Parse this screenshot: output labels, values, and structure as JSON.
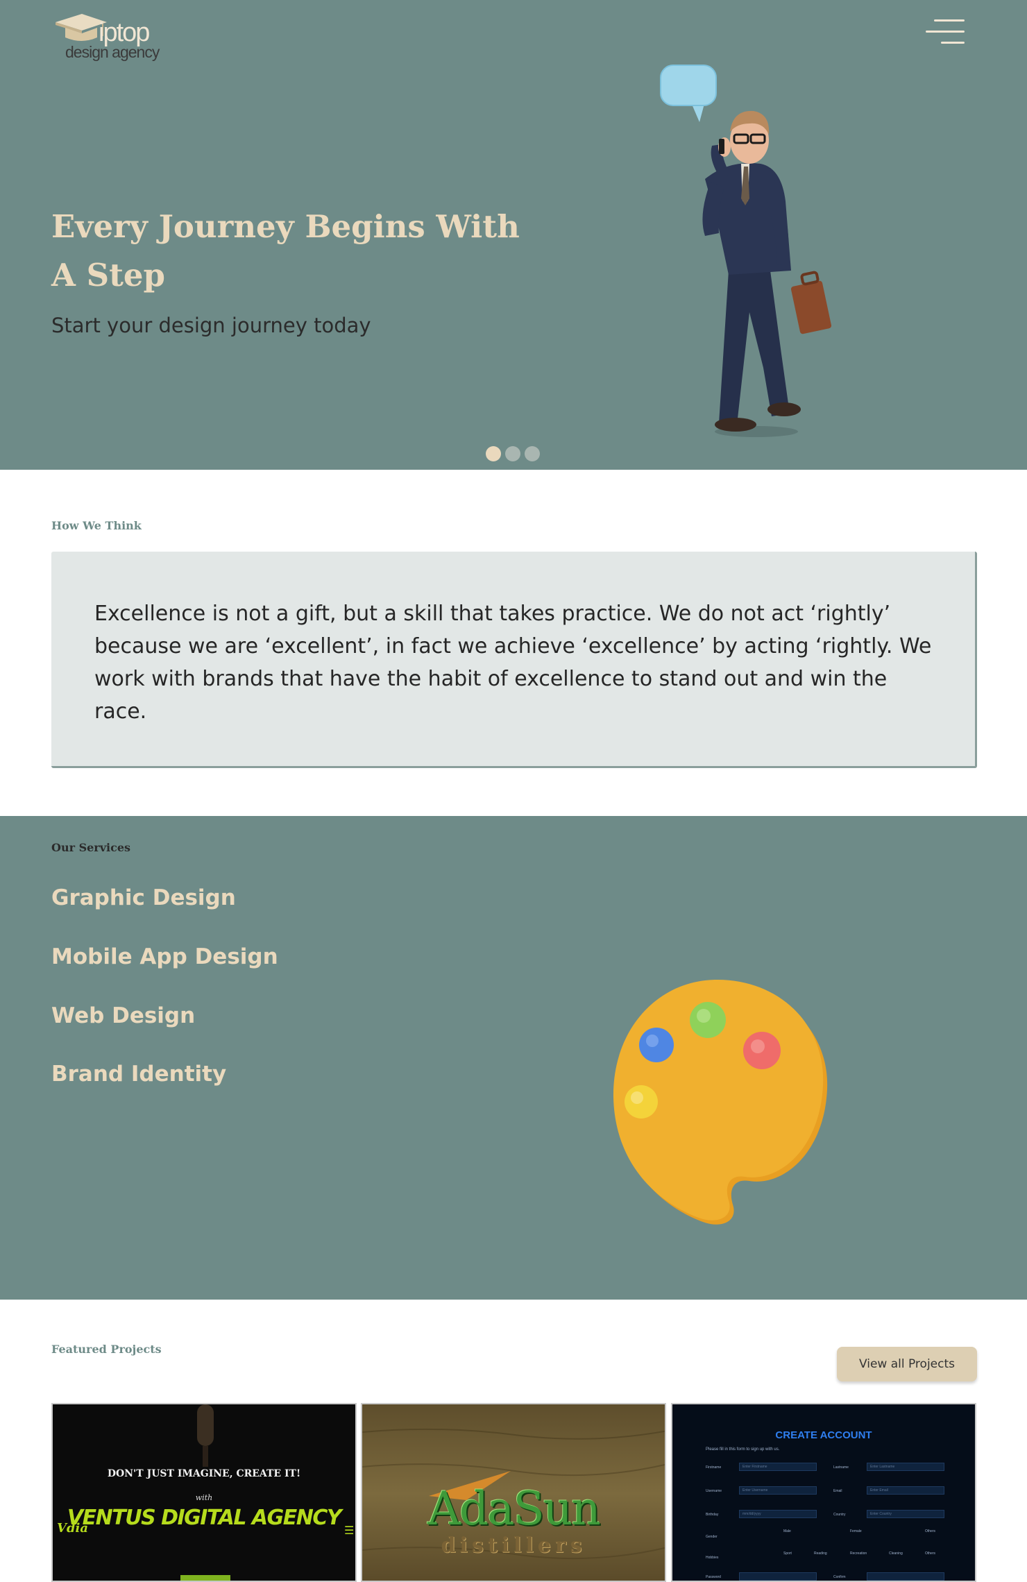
{
  "header": {
    "logo_brand": "iptop",
    "logo_tagline": "design agency",
    "menu_icon": "hamburger-menu-icon"
  },
  "hero": {
    "title": "Every Journey Begins With A Step",
    "subtitle": "Start your design journey today",
    "slides": 3,
    "active_slide": 0
  },
  "think": {
    "label": "How We Think",
    "quote": "Excellence is not a gift, but a skill that takes practice. We do not act ‘rightly’ because we are ‘excellent’, in fact we achieve ‘excellence’ by acting ‘rightly. We work with brands that have the habit of excellence to stand out and win the race."
  },
  "services": {
    "label": "Our Services",
    "items": [
      "Graphic Design",
      "Mobile App Design",
      "Web Design",
      "Brand Identity"
    ]
  },
  "featured": {
    "label": "Featured Projects",
    "view_all": "View all Projects",
    "projects": [
      {
        "headline": "DON'T JUST IMAGINE, CREATE IT!",
        "with": "with",
        "name": "VENTUS DIGITAL AGENCY",
        "logo": "Vdia",
        "menu": "☰"
      },
      {
        "name": "AdaSun",
        "sub": "distillers"
      },
      {
        "title": "CREATE ACCOUNT",
        "note": "Please fill in this form to sign up with us.",
        "fields": [
          {
            "label": "Firstname",
            "placeholder": "Enter Firstname"
          },
          {
            "label": "Lastname",
            "placeholder": "Enter Lastname"
          },
          {
            "label": "Username",
            "placeholder": "Enter Username"
          },
          {
            "label": "Email",
            "placeholder": "Enter Email"
          },
          {
            "label": "Birthday",
            "placeholder": "mm/dd/yyyy"
          },
          {
            "label": "Country",
            "placeholder": "Enter Country"
          }
        ],
        "gender_label": "Gender",
        "gender_options": [
          "Male",
          "Female",
          "Others"
        ],
        "hobbies_label": "Hobbies",
        "hobbies": [
          "Sport",
          "Reading",
          "Recreation",
          "Cleaning",
          "Others"
        ],
        "password_label": "Password",
        "confirm_label": "Confirm"
      }
    ]
  },
  "colors": {
    "sage": "#6e8b88",
    "beige": "#ead9bd",
    "button": "#ddcfb3",
    "quote_bg": "#e2e7e6"
  }
}
